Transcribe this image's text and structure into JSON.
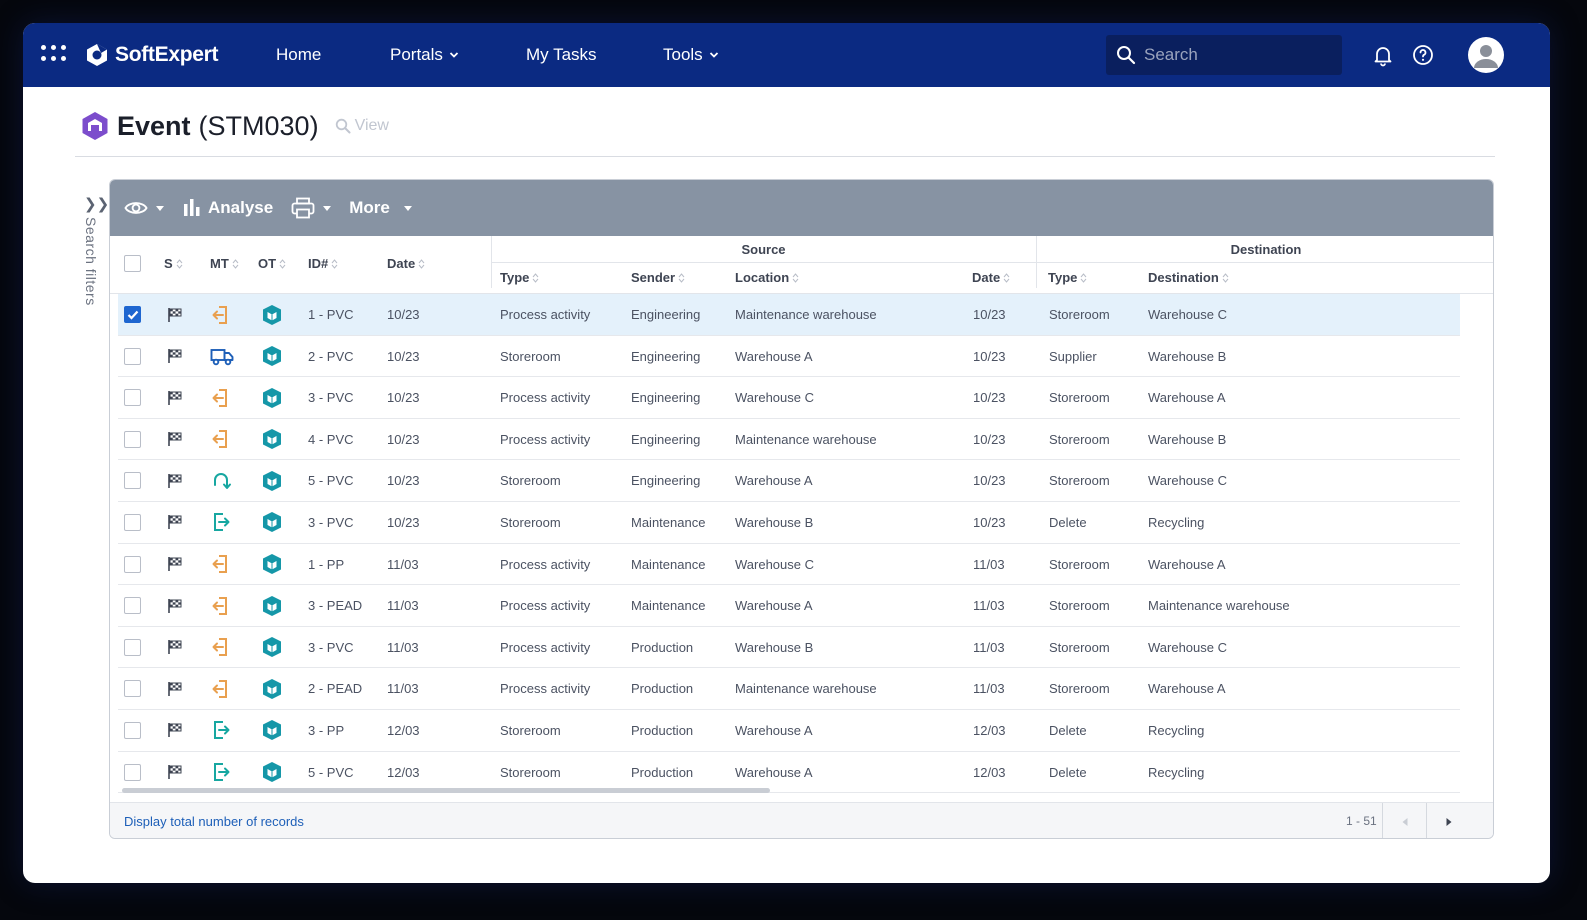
{
  "brand": {
    "name": "SoftExpert"
  },
  "nav": {
    "home": "Home",
    "portals": "Portals",
    "my_tasks": "My Tasks",
    "tools": "Tools",
    "search_placeholder": "Search"
  },
  "page": {
    "title": "Event",
    "code": "(STM030)",
    "view_label": "View",
    "side_filters": "Search filters"
  },
  "toolbar": {
    "analyse": "Analyse",
    "more": "More"
  },
  "columns": {
    "s": "S",
    "mt": "MT",
    "ot": "OT",
    "id": "ID#",
    "date": "Date",
    "source_group": "Source",
    "destination_group": "Destination",
    "src_type": "Type",
    "sender": "Sender",
    "location": "Location",
    "dst_date": "Date",
    "dst_type": "Type",
    "destination": "Destination"
  },
  "rows": [
    {
      "checked": true,
      "mt": "exit",
      "id": "1 - PVC",
      "date": "10/23",
      "src_type": "Process activity",
      "sender": "Engineering",
      "location": "Maintenance warehouse",
      "dst_date": "10/23",
      "dst_type": "Storeroom",
      "destination": "Warehouse C"
    },
    {
      "checked": false,
      "mt": "truck",
      "id": "2 - PVC",
      "date": "10/23",
      "src_type": "Storeroom",
      "sender": "Engineering",
      "location": "Warehouse A",
      "dst_date": "10/23",
      "dst_type": "Supplier",
      "destination": "Warehouse B"
    },
    {
      "checked": false,
      "mt": "exit",
      "id": "3 - PVC",
      "date": "10/23",
      "src_type": "Process activity",
      "sender": "Engineering",
      "location": "Warehouse C",
      "dst_date": "10/23",
      "dst_type": "Storeroom",
      "destination": "Warehouse A"
    },
    {
      "checked": false,
      "mt": "exit",
      "id": "4 - PVC",
      "date": "10/23",
      "src_type": "Process activity",
      "sender": "Engineering",
      "location": "Maintenance warehouse",
      "dst_date": "10/23",
      "dst_type": "Storeroom",
      "destination": "Warehouse B"
    },
    {
      "checked": false,
      "mt": "return",
      "id": "5 - PVC",
      "date": "10/23",
      "src_type": "Storeroom",
      "sender": "Engineering",
      "location": "Warehouse A",
      "dst_date": "10/23",
      "dst_type": "Storeroom",
      "destination": "Warehouse C"
    },
    {
      "checked": false,
      "mt": "out",
      "id": "3 - PVC",
      "date": "10/23",
      "src_type": "Storeroom",
      "sender": "Maintenance",
      "location": "Warehouse B",
      "dst_date": "10/23",
      "dst_type": "Delete",
      "destination": "Recycling"
    },
    {
      "checked": false,
      "mt": "exit",
      "id": "1 - PP",
      "date": "11/03",
      "src_type": "Process activity",
      "sender": "Maintenance",
      "location": "Warehouse C",
      "dst_date": "11/03",
      "dst_type": "Storeroom",
      "destination": "Warehouse A"
    },
    {
      "checked": false,
      "mt": "exit",
      "id": "3 - PEAD",
      "date": "11/03",
      "src_type": "Process activity",
      "sender": "Maintenance",
      "location": "Warehouse A",
      "dst_date": "11/03",
      "dst_type": "Storeroom",
      "destination": "Maintenance warehouse"
    },
    {
      "checked": false,
      "mt": "exit",
      "id": "3 - PVC",
      "date": "11/03",
      "src_type": "Process activity",
      "sender": "Production",
      "location": "Warehouse B",
      "dst_date": "11/03",
      "dst_type": "Storeroom",
      "destination": "Warehouse C"
    },
    {
      "checked": false,
      "mt": "exit",
      "id": "2 - PEAD",
      "date": "11/03",
      "src_type": "Process activity",
      "sender": "Production",
      "location": "Maintenance warehouse",
      "dst_date": "11/03",
      "dst_type": "Storeroom",
      "destination": "Warehouse A"
    },
    {
      "checked": false,
      "mt": "out",
      "id": "3 - PP",
      "date": "12/03",
      "src_type": "Storeroom",
      "sender": "Production",
      "location": "Warehouse A",
      "dst_date": "12/03",
      "dst_type": "Delete",
      "destination": "Recycling"
    },
    {
      "checked": false,
      "mt": "out",
      "id": "5 - PVC",
      "date": "12/03",
      "src_type": "Storeroom",
      "sender": "Production",
      "location": "Warehouse A",
      "dst_date": "12/03",
      "dst_type": "Delete",
      "destination": "Recycling"
    }
  ],
  "footer": {
    "total_link": "Display total number of records",
    "range": "1 - 51"
  },
  "colors": {
    "nav_bg": "#0b2a82",
    "toolbar_bg": "#8793a3",
    "selected_row": "#e4f1fb",
    "checkbox_checked": "#1e66d0",
    "mt_orange": "#e9a04f",
    "mt_blue": "#1d5fb8",
    "mt_teal": "#17a7a1",
    "ot_teal": "#1597a8",
    "event_purple": "#7c4dcc"
  },
  "icons": {
    "apps": "apps-grid-icon",
    "search": "search-icon",
    "bell": "bell-icon",
    "help": "help-circle-icon",
    "avatar": "user-avatar-icon",
    "eye": "eye-icon",
    "analyse": "bar-chart-icon",
    "print": "printer-icon",
    "flag": "checkered-flag-icon",
    "ot": "shield-box-icon"
  }
}
